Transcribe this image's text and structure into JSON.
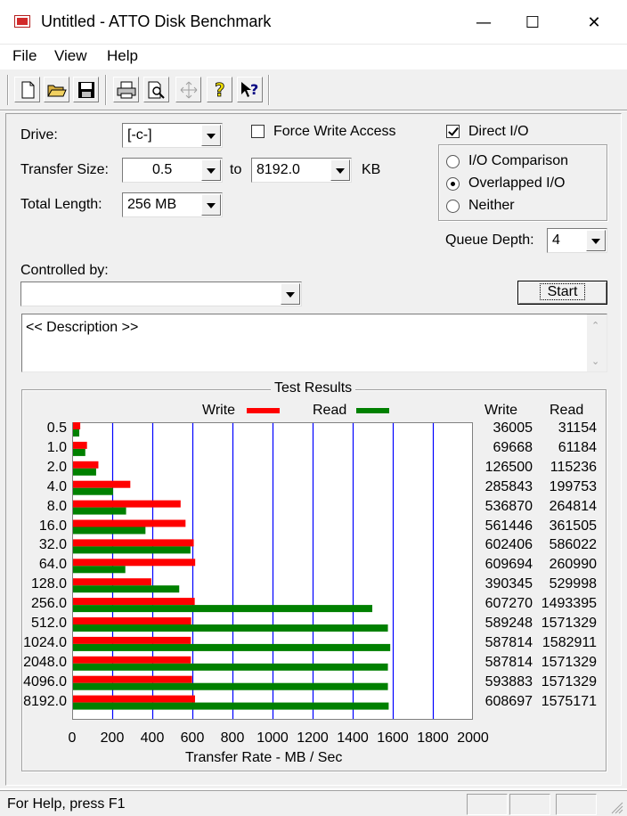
{
  "window": {
    "title": "Untitled - ATTO Disk Benchmark",
    "minimize_glyph": "—",
    "maximize_glyph": "☐",
    "close_glyph": "✕"
  },
  "menu": [
    "File",
    "View",
    "Help"
  ],
  "toolbar": {
    "buttons": [
      "new-document-icon",
      "open-folder-icon",
      "save-disk-icon",
      "print-icon",
      "print-preview-icon",
      "move-arrows-icon",
      "help-question-icon",
      "context-help-icon"
    ]
  },
  "form": {
    "drive_label": "Drive:",
    "drive_value": "[-c-]",
    "transfer_size_label": "Transfer Size:",
    "transfer_from": "0.5",
    "to_label": "to",
    "transfer_to": "8192.0",
    "kb_label": "KB",
    "total_length_label": "Total Length:",
    "total_length_value": "256 MB",
    "force_write_label": "Force Write Access",
    "force_write_checked": false,
    "direct_io_label": "Direct I/O",
    "direct_io_checked": true,
    "radios": [
      {
        "label": "I/O Comparison",
        "checked": false
      },
      {
        "label": "Overlapped I/O",
        "checked": true
      },
      {
        "label": "Neither",
        "checked": false
      }
    ],
    "queue_depth_label": "Queue Depth:",
    "queue_depth_value": "4",
    "controlled_by_label": "Controlled by:",
    "controlled_by_value": "",
    "start_label": "Start",
    "description": "<< Description >>"
  },
  "results": {
    "title": "Test Results",
    "write_col": "Write",
    "read_col": "Read"
  },
  "chart_data": {
    "type": "bar",
    "orientation": "horizontal",
    "categories": [
      "0.5",
      "1.0",
      "2.0",
      "4.0",
      "8.0",
      "16.0",
      "32.0",
      "64.0",
      "128.0",
      "256.0",
      "512.0",
      "1024.0",
      "2048.0",
      "4096.0",
      "8192.0"
    ],
    "series": [
      {
        "name": "Write",
        "color": "#ff0000",
        "values": [
          36005,
          69668,
          126500,
          285843,
          536870,
          561446,
          602406,
          609694,
          390345,
          607270,
          589248,
          587814,
          587814,
          593883,
          608697
        ]
      },
      {
        "name": "Read",
        "color": "#008000",
        "values": [
          31154,
          61184,
          115236,
          199753,
          264814,
          361505,
          586022,
          260990,
          529998,
          1493395,
          1571329,
          1582911,
          1571329,
          1571329,
          1575171
        ]
      }
    ],
    "write_text": [
      "36005",
      "69668",
      "126500",
      "285843",
      "536870",
      "561446",
      "602406",
      "609694",
      "390345",
      "607270",
      "589248",
      "587814",
      "587814",
      "593883",
      "608697"
    ],
    "read_text": [
      "31154",
      "61184",
      "115236",
      "199753",
      "264814",
      "361505",
      "586022",
      "260990",
      "529998",
      "1493395",
      "1571329",
      "1582911",
      "1571329",
      "1571329",
      "1575171"
    ],
    "xticks": [
      "0",
      "200",
      "400",
      "600",
      "800",
      "1000",
      "1200",
      "1400",
      "1600",
      "1800",
      "2000"
    ],
    "xlim": [
      0,
      2000
    ],
    "xlabel": "Transfer Rate - MB / Sec",
    "legend_position": "top",
    "grid_color": "#0000ff"
  },
  "status": {
    "text": "For Help, press F1"
  }
}
